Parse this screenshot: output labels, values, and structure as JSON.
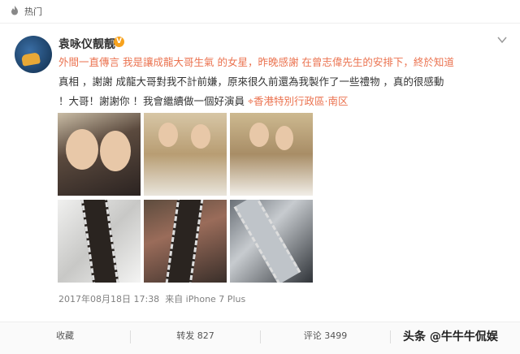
{
  "topbar": {
    "hot_label": "热门",
    "hot_icon": "flame-icon"
  },
  "post": {
    "username": "袁咏仪靓靓",
    "verified_badge": "V",
    "text_parts": [
      {
        "t": "外間一直傳言",
        "c": "hl"
      },
      {
        "t": "我是讓",
        "c": "hl2"
      },
      {
        "t": "成龍",
        "c": "link"
      },
      {
        "t": "大哥生氣",
        "c": ""
      },
      {
        "t": "的女星，昨晚感謝",
        "c": ""
      },
      {
        "t": "在曾志偉先生的安排下，終於知道",
        "c": ""
      }
    ],
    "line1": "外間一直傳言 我是讓成龍大哥生氣 的女星，昨晚感謝 在曾志偉先生的安排下，終於知道",
    "line2": "真相 ，謝謝 成龍大哥對我不計前嫌，原來很久前還為我製作了一些禮物 ，真的很感動",
    "line3": "！大哥！謝謝你 ！我會繼續做一個好演員",
    "location": "香港特別行政區·南区",
    "timestamp": "2017年08月18日 17:38",
    "source": "来自 iPhone 7 Plus"
  },
  "actions": {
    "favorite": "收藏",
    "repost": "转发 827",
    "comment": "评论 3499",
    "like": "",
    "watermark": "头条 @牛牛牛侃娱"
  },
  "colors": {
    "accent": "#eb7350",
    "badge": "#f7a21d"
  }
}
